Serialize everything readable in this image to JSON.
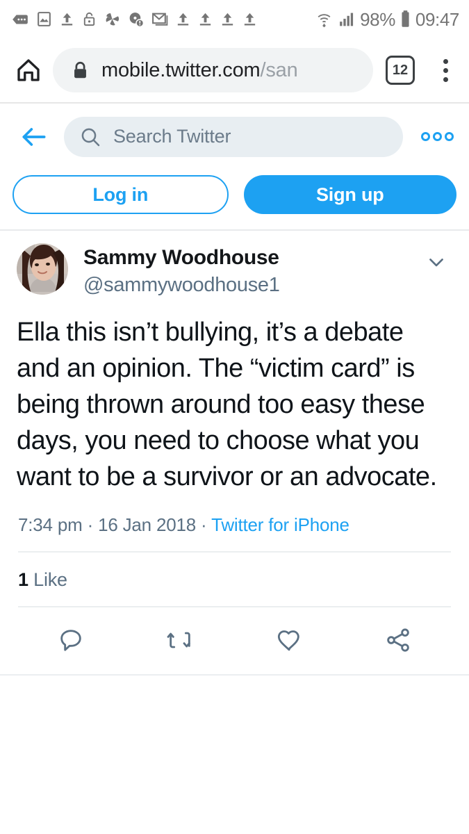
{
  "status_bar": {
    "icons": [
      "message-dots-icon",
      "photo-icon",
      "upload-icon",
      "unlock-icon",
      "pinwheel-icon",
      "disc-alert-icon",
      "gmail-icon",
      "upload-icon",
      "upload-icon",
      "upload-icon",
      "upload-icon"
    ],
    "wifi_icon": "wifi-icon",
    "signal_icon": "signal-bars-icon",
    "battery_percent": "98%",
    "battery_icon": "battery-full-icon",
    "clock": "09:47"
  },
  "browser": {
    "home_icon": "home-icon",
    "lock_icon": "lock-icon",
    "url_domain": "mobile.twitter.com",
    "url_path": "/san",
    "tab_count": "12",
    "menu_icon": "kebab-menu-icon"
  },
  "twitter_header": {
    "back_icon": "back-arrow-icon",
    "search_icon": "search-icon",
    "search_placeholder": "Search Twitter",
    "search_value": "",
    "more_icon": "more-circles-icon"
  },
  "auth": {
    "login_label": "Log in",
    "signup_label": "Sign up"
  },
  "tweet": {
    "avatar_alt": "avatar",
    "display_name": "Sammy Woodhouse",
    "handle": "@sammywoodhouse1",
    "caret_icon": "chevron-down-icon",
    "text": "Ella this isn’t bullying, it’s a debate and an opinion. The “victim card” is being thrown around too easy these days, you need to choose what you want to be a survivor or an advocate.",
    "time": "7:34 pm",
    "separator_1": "·",
    "date": "16 Jan 2018",
    "separator_2": "·",
    "source": "Twitter for iPhone",
    "like_count": "1",
    "like_label": "Like",
    "actions": [
      {
        "name": "reply-button",
        "icon": "reply-icon"
      },
      {
        "name": "retweet-button",
        "icon": "retweet-icon"
      },
      {
        "name": "like-button",
        "icon": "heart-icon"
      },
      {
        "name": "share-button",
        "icon": "share-icon"
      }
    ]
  },
  "colors": {
    "twitter_blue": "#1da1f2",
    "text_dark": "#0f1419",
    "text_muted": "#5b7083",
    "search_bg": "#e8eef2",
    "omnibox_bg": "#f1f3f4"
  }
}
